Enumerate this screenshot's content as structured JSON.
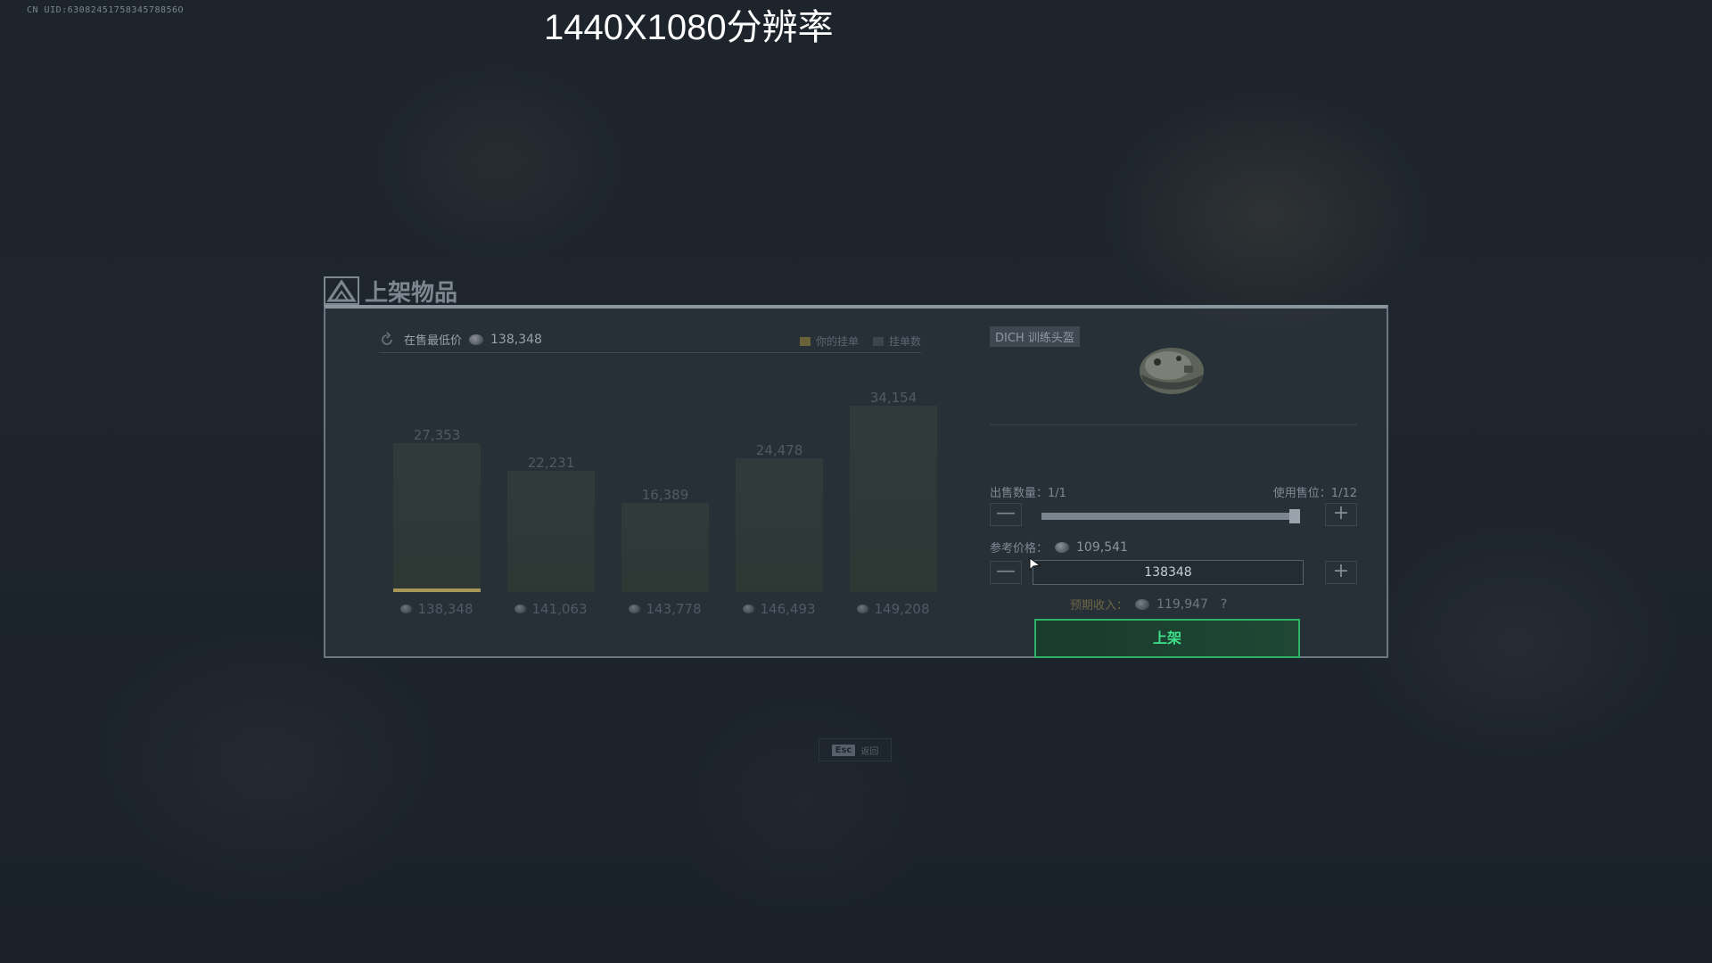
{
  "uid_text": "CN UID:6308245175834578856O",
  "resolution_caption": "1440X1080分辨率",
  "dialog": {
    "title": "上架物品"
  },
  "market": {
    "lowest_label": "在售最低价",
    "lowest_price": "138,348",
    "legend": [
      {
        "label": "你的挂单",
        "color": "#6a6238"
      },
      {
        "label": "挂单数",
        "color": "#3c454e"
      }
    ]
  },
  "chart_data": {
    "type": "bar",
    "categories": [
      "138,348",
      "141,063",
      "143,778",
      "146,493",
      "149,208"
    ],
    "values": [
      27353,
      22231,
      16389,
      24478,
      34154
    ],
    "value_labels": [
      "27,353",
      "22,231",
      "16,389",
      "24,478",
      "34,154"
    ],
    "ylim": [
      0,
      36000
    ],
    "my_listing_category": "138,348",
    "xlabel": "",
    "ylabel": ""
  },
  "item": {
    "name": "DICH 训练头盔",
    "icon": "helmet-icon"
  },
  "sale": {
    "quantity_label": "出售数量：1/1",
    "slot_label": "使用售位：1/12",
    "quantity_fraction": 1.0,
    "reference_label": "参考价格：",
    "reference_price": "109,541",
    "price_input_value": "138348",
    "expected_label": "预期收入：",
    "expected_income": "119,947",
    "help_symbol": "?",
    "list_button": "上架",
    "minus_symbol": "—",
    "plus_symbol": "+"
  },
  "esc_hint": {
    "key": "Esc",
    "label": "返回"
  },
  "colors": {
    "accent_green": "#2bb266",
    "my_listing": "#a89858"
  }
}
